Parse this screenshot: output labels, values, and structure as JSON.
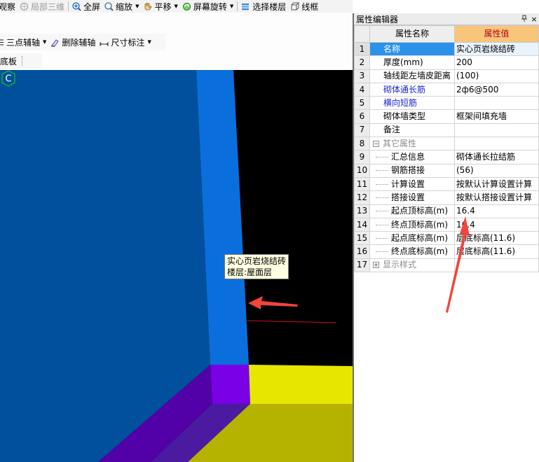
{
  "toolbar_top": {
    "observe": "观察",
    "local_3d": "局部三维",
    "fullscreen": "全屏",
    "zoom": "缩放",
    "pan": "平移",
    "rotate": "屏幕旋转",
    "select_floor": "选择楼层",
    "wireframe": "线框"
  },
  "toolbar_axis": {
    "three_point_axis": "三点辅轴",
    "delete_axis": "删除辅轴",
    "dimension": "尺寸标注"
  },
  "toolbar_left": {
    "slab_bottom": "底板"
  },
  "viewport": {
    "tooltip_line1": "实心页岩烧结砖",
    "tooltip_line2": "楼层:屋面层",
    "snap_marker": "C",
    "colors": {
      "background": "#000000",
      "wall_dark": "#00509d",
      "wall_light": "#0a6fdc",
      "purple": "#7a00e6",
      "purple_dark": "#5200a8",
      "yellow": "#e6e600",
      "olive": "#b5b300",
      "arrow": "#f0453a"
    }
  },
  "panel": {
    "title": "属性编辑器",
    "pin": "ᵖ",
    "close": "×",
    "col_name": "属性名称",
    "col_value": "属性值",
    "rows": [
      {
        "num": "1",
        "name": "名称",
        "value": "实心页岩烧结砖"
      },
      {
        "num": "2",
        "name": "厚度(mm)",
        "value": "200"
      },
      {
        "num": "3",
        "name": "轴线距左墙皮距离",
        "value": "(100)"
      },
      {
        "num": "4",
        "name": "砌体通长筋",
        "value": "2ф6@500"
      },
      {
        "num": "5",
        "name": "横向短筋",
        "value": ""
      },
      {
        "num": "6",
        "name": "砌体墙类型",
        "value": "框架间填充墙"
      },
      {
        "num": "7",
        "name": "备注",
        "value": ""
      },
      {
        "num": "8",
        "name": "其它属性",
        "value": "",
        "toggle": "−"
      },
      {
        "num": "9",
        "name": "汇总信息",
        "value": "砌体通长拉结筋"
      },
      {
        "num": "10",
        "name": "钢筋搭接",
        "value": "(56)"
      },
      {
        "num": "11",
        "name": "计算设置",
        "value": "按默认计算设置计算"
      },
      {
        "num": "12",
        "name": "搭接设置",
        "value": "按默认搭接设置计算"
      },
      {
        "num": "13",
        "name": "起点顶标高(m)",
        "value": "16.4"
      },
      {
        "num": "14",
        "name": "终点顶标高(m)",
        "value": "16.4"
      },
      {
        "num": "15",
        "name": "起点底标高(m)",
        "value": "层底标高(11.6)"
      },
      {
        "num": "16",
        "name": "终点底标高(m)",
        "value": "层底标高(11.6)"
      },
      {
        "num": "17",
        "name": "显示样式",
        "value": "",
        "toggle": "+"
      }
    ]
  }
}
